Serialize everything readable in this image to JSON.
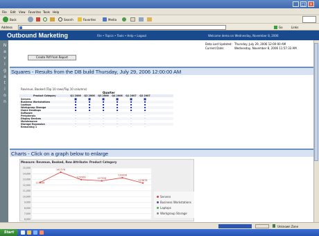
{
  "browser": {
    "menu": [
      "File",
      "Edit",
      "View",
      "Favorites",
      "Tools",
      "Help"
    ],
    "toolbar": [
      "Back",
      "Search",
      "Favorites",
      "Media"
    ],
    "address_label": "Address",
    "go_label": "Go",
    "links_label": "Links"
  },
  "app": {
    "title": "Outbound Marketing",
    "nav": "File • Topics • Tools • Help • Logout",
    "welcome": "Welcome demo on Wednesday, November 8, 2006",
    "left_nav_letters": [
      "N",
      "a",
      "v",
      "i",
      "g",
      "a",
      "t",
      "i",
      "o",
      "n"
    ],
    "pdf_button": "Create Pdf from Report",
    "last_updated_label": "Data Last Updated:",
    "last_updated_value": "Thursday, July 29, 2006 12:00:00 AM",
    "current_date_label": "Current Date:",
    "current_date_value": "Wednesday, November 8, 2006 11:57:33 AM"
  },
  "squares": {
    "title": "Squares - Results from the DB build Thursday, July 29, 2006 12:00:00 AM",
    "caption": "Revenue, Booked (Top 10 rows/Top 10 columns)",
    "group_header": "Quarter",
    "row_header": "Product Category",
    "columns": [
      "Q1 2006",
      "Q2 2006",
      "Q3 2006",
      "Q4 2006",
      "Q1 2007",
      "Q2 2007"
    ],
    "rows": [
      {
        "label": "Servers",
        "cells": [
          "■",
          "■",
          "■",
          "■",
          "■",
          "■"
        ]
      },
      {
        "label": "Business Workstations",
        "cells": [
          "▪",
          "▪",
          "▪",
          "▪",
          "▪",
          "▪"
        ]
      },
      {
        "label": "Laptops",
        "cells": [
          "▪",
          "▪",
          "▪",
          "▪",
          "▪",
          "▪"
        ]
      },
      {
        "label": "Workgroup Storage",
        "cells": [
          "▪",
          "▪",
          "▪",
          "▪",
          "▪",
          "▪"
        ]
      },
      {
        "label": "Home Desktops",
        "cells": [
          "▪",
          "▪",
          "▪",
          "▪",
          "▪",
          "▪"
        ]
      },
      {
        "label": "Software",
        "cells": [
          "·",
          "·",
          "·",
          "·",
          "·",
          "·"
        ]
      },
      {
        "label": "Peripherals",
        "cells": [
          "·",
          "·",
          "·",
          "·",
          "·",
          "·"
        ]
      },
      {
        "label": "Display Devices",
        "cells": [
          "·",
          "·",
          "·",
          "·",
          "·",
          "·"
        ]
      },
      {
        "label": "Maintenance",
        "cells": [
          "·",
          "·",
          "·",
          "·",
          "·",
          "·"
        ]
      },
      {
        "label": "Storage Expansion",
        "cells": [
          "·",
          "·",
          "·",
          "·",
          "·",
          "·"
        ]
      },
      {
        "label": "Remaining 1",
        "cells": [
          "·",
          "·",
          "·",
          "·",
          "·",
          "·"
        ]
      }
    ]
  },
  "charts": {
    "title": "Charts - Click on a graph below to enlarge",
    "chart_title": "Measure: Revenue, Booked, Row Attribute: Product Category",
    "yticks": [
      "15,000",
      "14,000",
      "13,000",
      "12,000",
      "11,000",
      "10,000",
      "9,000",
      "8,000",
      "7,000",
      "6,000"
    ],
    "point_labels": [
      "124936",
      "142578",
      "129560",
      "127526",
      "132898",
      "123678"
    ],
    "legend": [
      "Servers",
      "Business Workstations",
      "Laptops",
      "Workgroup Storage"
    ],
    "legend_colors": [
      "#e0443e",
      "#5b47a8",
      "#4caf50",
      "#8a8a8a"
    ]
  },
  "chart_data": {
    "type": "line",
    "title": "Measure: Revenue, Booked, Row Attribute: Product Category",
    "ylim": [
      6000,
      15000
    ],
    "series": [
      {
        "name": "Servers",
        "values": [
          12494,
          14258,
          12956,
          12753,
          13290,
          12368
        ]
      }
    ]
  },
  "status": {
    "zone": "Unknown Zone"
  },
  "taskbar": {
    "start": "Start"
  }
}
